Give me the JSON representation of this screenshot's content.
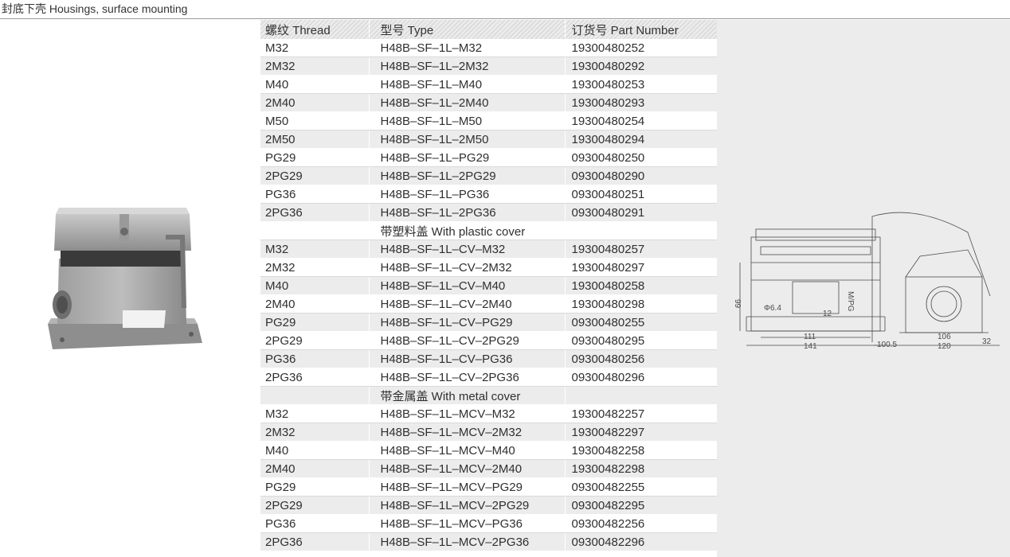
{
  "section_title": "封底下壳 Housings, surface mounting",
  "table": {
    "headers": [
      "螺纹 Thread",
      "型号 Type",
      "订货号 Part Number"
    ],
    "rows": [
      [
        "M32",
        "H48B–SF–1L–M32",
        "19300480252"
      ],
      [
        "2M32",
        "H48B–SF–1L–2M32",
        "19300480292"
      ],
      [
        "M40",
        "H48B–SF–1L–M40",
        "19300480253"
      ],
      [
        "2M40",
        "H48B–SF–1L–2M40",
        "19300480293"
      ],
      [
        "M50",
        "H48B–SF–1L–M50",
        "19300480254"
      ],
      [
        "2M50",
        "H48B–SF–1L–2M50",
        "19300480294"
      ],
      [
        "PG29",
        "H48B–SF–1L–PG29",
        "09300480250"
      ],
      [
        "2PG29",
        "H48B–SF–1L–2PG29",
        "09300480290"
      ],
      [
        "PG36",
        "H48B–SF–1L–PG36",
        "09300480251"
      ],
      [
        "2PG36",
        "H48B–SF–1L–2PG36",
        "09300480291"
      ],
      [
        "",
        "带塑料盖 With plastic cover",
        ""
      ],
      [
        "M32",
        "H48B–SF–1L–CV–M32",
        "19300480257"
      ],
      [
        "2M32",
        "H48B–SF–1L–CV–2M32",
        "19300480297"
      ],
      [
        "M40",
        "H48B–SF–1L–CV–M40",
        "19300480258"
      ],
      [
        "2M40",
        "H48B–SF–1L–CV–2M40",
        "19300480298"
      ],
      [
        "PG29",
        "H48B–SF–1L–CV–PG29",
        "09300480255"
      ],
      [
        "2PG29",
        "H48B–SF–1L–CV–2PG29",
        "09300480295"
      ],
      [
        "PG36",
        "H48B–SF–1L–CV–PG36",
        "09300480256"
      ],
      [
        "2PG36",
        "H48B–SF–1L–CV–2PG36",
        "09300480296"
      ],
      [
        "",
        "带金属盖 With metal cover",
        ""
      ],
      [
        "M32",
        "H48B–SF–1L–MCV–M32",
        "19300482257"
      ],
      [
        "2M32",
        "H48B–SF–1L–MCV–2M32",
        "19300482297"
      ],
      [
        "M40",
        "H48B–SF–1L–MCV–M40",
        "19300482258"
      ],
      [
        "2M40",
        "H48B–SF–1L–MCV–2M40",
        "19300482298"
      ],
      [
        "PG29",
        "H48B–SF–1L–MCV–PG29",
        "09300482255"
      ],
      [
        "2PG29",
        "H48B–SF–1L–MCV–2PG29",
        "09300482295"
      ],
      [
        "PG36",
        "H48B–SF–1L–MCV–PG36",
        "09300482256"
      ],
      [
        "2PG36",
        "H48B–SF–1L–MCV–2PG36",
        "09300482296"
      ]
    ]
  },
  "drawing": {
    "dim_height": "99",
    "dim_hole": "Φ6.4",
    "dim_12": "12",
    "dim_thread": "M/PG",
    "dim_111": "111",
    "dim_141": "141",
    "dim_100_5": "100.5",
    "dim_106": "106",
    "dim_120": "120",
    "dim_32": "32"
  }
}
